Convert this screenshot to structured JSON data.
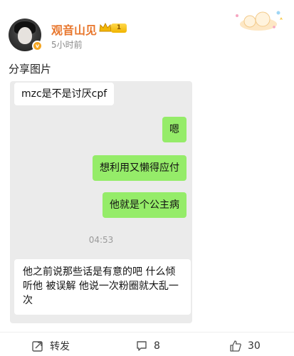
{
  "post": {
    "username": "观音山见",
    "level": "1",
    "time": "5小时前",
    "vip_badge": "v",
    "text": "分享图片"
  },
  "chat": {
    "messages": [
      {
        "side": "in",
        "text": "mzc是不是讨厌cpf"
      },
      {
        "side": "out",
        "text": "嗯"
      },
      {
        "side": "out",
        "text": "想利用又懒得应付"
      },
      {
        "side": "out",
        "text": "他就是个公主病"
      },
      {
        "side": "in",
        "text": "他之前说那些话是有意的吧 什么倾听他 被误解 他说一次粉圈就大乱一次"
      }
    ],
    "timestamp": "04:53"
  },
  "actions": {
    "repost_label": "转发",
    "comment_count": "8",
    "like_count": "30"
  },
  "colors": {
    "username": "#e8762c",
    "outgoing_bubble": "#95ec69",
    "chat_background": "#ebebeb"
  }
}
